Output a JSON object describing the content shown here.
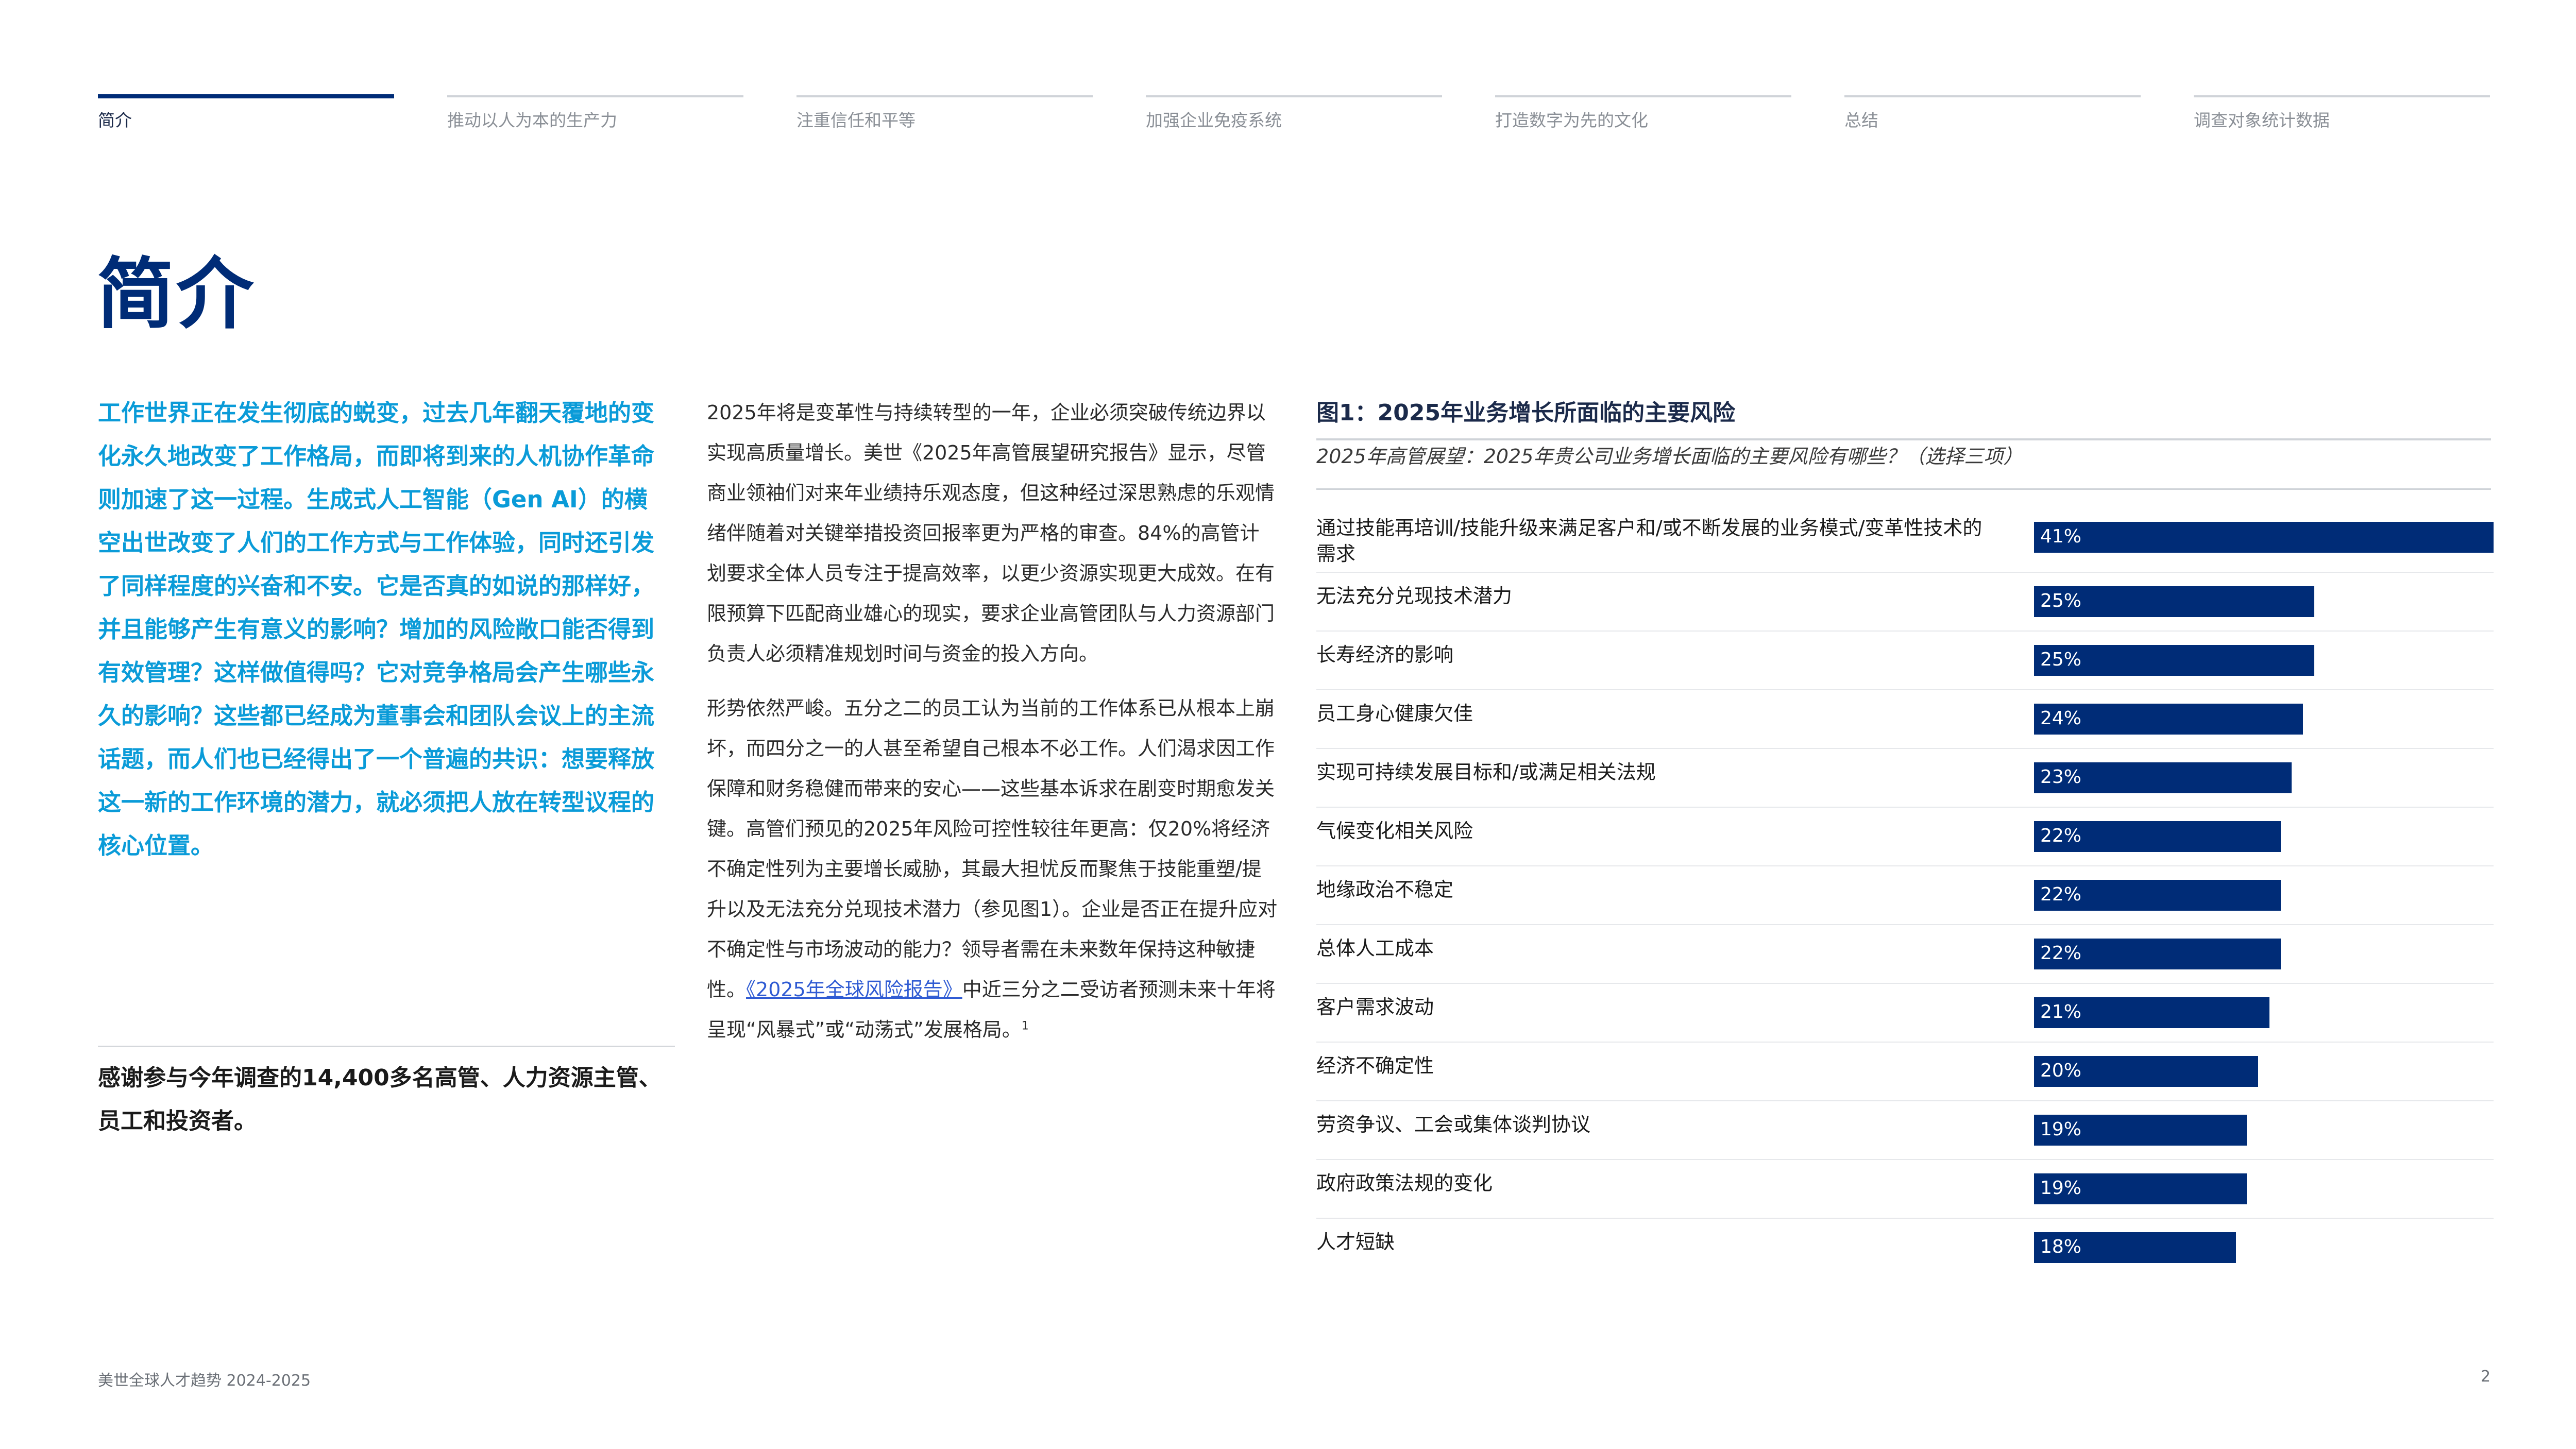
{
  "nav": {
    "tabs": [
      {
        "label": "简介"
      },
      {
        "label": "推动以人为本的生产力"
      },
      {
        "label": "注重信任和平等"
      },
      {
        "label": "加强企业免疫系统"
      },
      {
        "label": "打造数字为先的文化"
      },
      {
        "label": "总结"
      },
      {
        "label": "调查对象统计数据"
      }
    ],
    "active_index": 0
  },
  "page": {
    "title": "简介",
    "lead": "工作世界正在发生彻底的蜕变，过去几年翻天覆地的变化永久地改变了工作格局，而即将到来的人机协作革命则加速了这一过程。生成式人工智能（Gen AI）的横空出世改变了人们的工作方式与工作体验，同时还引发了同样程度的兴奋和不安。它是否真的如说的那样好，并且能够产生有意义的影响？增加的风险敞口能否得到有效管理？这样做值得吗？它对竞争格局会产生哪些永久的影响？这些都已经成为董事会和团队会议上的主流话题，而人们也已经得出了一个普遍的共识：想要释放这一新的工作环境的潜力，就必须把人放在转型议程的核心位置。",
    "thanks": "感谢参与今年调查的14,400多名高管、人力资源主管、员工和投资者。",
    "body_p1": "2025年将是变革性与持续转型的一年，企业必须突破传统边界以实现高质量增长。美世《2025年高管展望研究报告》显示，尽管商业领袖们对来年业绩持乐观态度，但这种经过深思熟虑的乐观情绪伴随着对关键举措投资回报率更为严格的审查。84%的高管计划要求全体人员专注于提高效率，以更少资源实现更大成效。在有限预算下匹配商业雄心的现实，要求企业高管团队与人力资源部门负责人必须精准规划时间与资金的投入方向。",
    "body_p2_a": "形势依然严峻。五分之二的员工认为当前的工作体系已从根本上崩坏，而四分之一的人甚至希望自己根本不必工作。人们渴求因工作保障和财务稳健而带来的安心——这些基本诉求在剧变时期愈发关键。高管们预见的2025年风险可控性较往年更高：仅20%将经济不确定性列为主要增长威胁，其最大担忧反而聚焦于技能重塑/提升以及无法充分兑现技术潜力（参见图1）。企业是否正在提升应对不确定性与市场波动的能力？领导者需在未来数年保持这种敏捷性。",
    "body_p2_link": "《2025年全球风险报告》",
    "body_p2_b": "中近三分之二受访者预测未来十年将呈现“风暴式”或“动荡式”发展格局。",
    "body_p2_sup": "1"
  },
  "chart_data": {
    "type": "bar",
    "orientation": "horizontal",
    "title": "图1：2025年业务增长所面临的主要风险",
    "subtitle": "2025年高管展望：2025年贵公司业务增长面临的主要风险有哪些？（选择三项）",
    "categories": [
      "通过技能再培训/技能升级来满足客户和/或不断发展的业务模式/变革性技术的需求",
      "无法充分兑现技术潜力",
      "长寿经济的影响",
      "员工身心健康欠佳",
      "实现可持续发展目标和/或满足相关法规",
      "气候变化相关风险",
      "地缘政治不稳定",
      "总体人工成本",
      "客户需求波动",
      "经济不确定性",
      "劳资争议、工会或集体谈判协议",
      "政府政策法规的变化",
      "人才短缺"
    ],
    "values": [
      41,
      25,
      25,
      24,
      23,
      22,
      22,
      22,
      21,
      20,
      19,
      19,
      18
    ],
    "value_labels": [
      "41%",
      "25%",
      "25%",
      "24%",
      "23%",
      "22%",
      "22%",
      "22%",
      "21%",
      "20%",
      "19%",
      "19%",
      "18%"
    ],
    "xlim": [
      0,
      41
    ],
    "bar_color": "#002c77"
  },
  "footer": {
    "left": "美世全球人才趋势 2024-2025",
    "page_number": "2"
  }
}
